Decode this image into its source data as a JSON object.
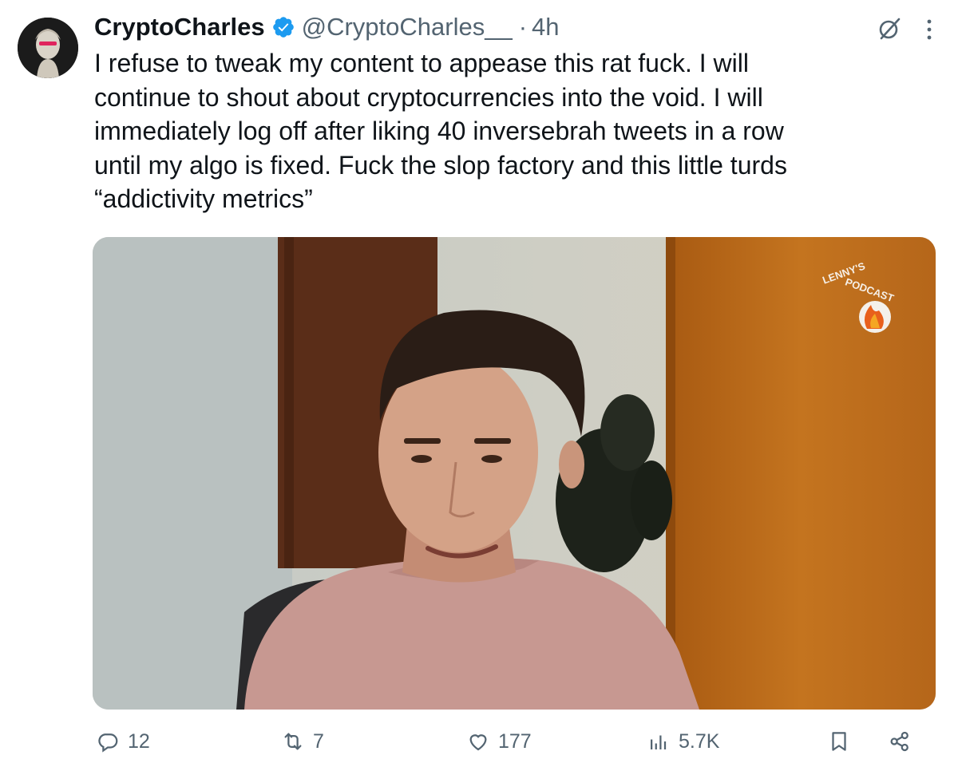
{
  "tweet": {
    "display_name": "CryptoCharles",
    "handle": "@CryptoCharles__",
    "separator": "·",
    "time": "4h",
    "text": "I refuse to tweak my content to appease this rat fuck. I will\ncontinue to shout about cryptocurrencies into the void. I will\nimmediately log off after liking 40 inversebrah tweets in a row\nuntil my algo is fixed. Fuck the slop factory and this little turds\n“addictivity metrics”",
    "verified_badge": "verified-badge-icon",
    "media_watermark": "LENNY'S PODCAST"
  },
  "actions": {
    "replies": "12",
    "reposts": "7",
    "likes": "177",
    "views": "5.7K"
  },
  "colors": {
    "text": "#0f1419",
    "secondary": "#536471",
    "verified": "#1d9bf0"
  }
}
